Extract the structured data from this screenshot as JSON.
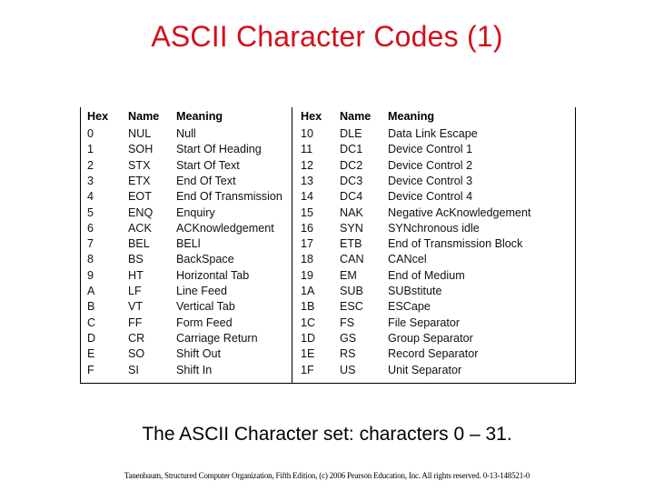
{
  "slide": {
    "title": "ASCII Character Codes (1)",
    "caption": "The ASCII Character set: characters 0 – 31.",
    "footer": "Tanenbaum, Structured Computer Organization, Fifth Edition, (c) 2006 Pearson Education, Inc. All rights reserved. 0-13-148521-0"
  },
  "table": {
    "headers": {
      "hex": "Hex",
      "name": "Name",
      "meaning": "Meaning"
    },
    "left": [
      {
        "hex": "0",
        "name": "NUL",
        "meaning": "Null"
      },
      {
        "hex": "1",
        "name": "SOH",
        "meaning": "Start Of Heading"
      },
      {
        "hex": "2",
        "name": "STX",
        "meaning": "Start Of Text"
      },
      {
        "hex": "3",
        "name": "ETX",
        "meaning": "End Of Text"
      },
      {
        "hex": "4",
        "name": "EOT",
        "meaning": "End Of Transmission"
      },
      {
        "hex": "5",
        "name": "ENQ",
        "meaning": "Enquiry"
      },
      {
        "hex": "6",
        "name": "ACK",
        "meaning": "ACKnowledgement"
      },
      {
        "hex": "7",
        "name": "BEL",
        "meaning": "BELl"
      },
      {
        "hex": "8",
        "name": "BS",
        "meaning": "BackSpace"
      },
      {
        "hex": "9",
        "name": "HT",
        "meaning": "Horizontal Tab"
      },
      {
        "hex": "A",
        "name": "LF",
        "meaning": "Line Feed"
      },
      {
        "hex": "B",
        "name": "VT",
        "meaning": "Vertical Tab"
      },
      {
        "hex": "C",
        "name": "FF",
        "meaning": "Form Feed"
      },
      {
        "hex": "D",
        "name": "CR",
        "meaning": "Carriage Return"
      },
      {
        "hex": "E",
        "name": "SO",
        "meaning": "Shift Out"
      },
      {
        "hex": "F",
        "name": "SI",
        "meaning": "Shift In"
      }
    ],
    "right": [
      {
        "hex": "10",
        "name": "DLE",
        "meaning": "Data Link Escape"
      },
      {
        "hex": "11",
        "name": "DC1",
        "meaning": "Device Control 1"
      },
      {
        "hex": "12",
        "name": "DC2",
        "meaning": "Device Control 2"
      },
      {
        "hex": "13",
        "name": "DC3",
        "meaning": "Device Control 3"
      },
      {
        "hex": "14",
        "name": "DC4",
        "meaning": "Device Control 4"
      },
      {
        "hex": "15",
        "name": "NAK",
        "meaning": "Negative AcKnowledgement"
      },
      {
        "hex": "16",
        "name": "SYN",
        "meaning": "SYNchronous idle"
      },
      {
        "hex": "17",
        "name": "ETB",
        "meaning": "End of Transmission Block"
      },
      {
        "hex": "18",
        "name": "CAN",
        "meaning": "CANcel"
      },
      {
        "hex": "19",
        "name": "EM",
        "meaning": "End of Medium"
      },
      {
        "hex": "1A",
        "name": "SUB",
        "meaning": "SUBstitute"
      },
      {
        "hex": "1B",
        "name": "ESC",
        "meaning": "ESCape"
      },
      {
        "hex": "1C",
        "name": "FS",
        "meaning": "File Separator"
      },
      {
        "hex": "1D",
        "name": "GS",
        "meaning": "Group Separator"
      },
      {
        "hex": "1E",
        "name": "RS",
        "meaning": "Record Separator"
      },
      {
        "hex": "1F",
        "name": "US",
        "meaning": "Unit Separator"
      }
    ]
  }
}
